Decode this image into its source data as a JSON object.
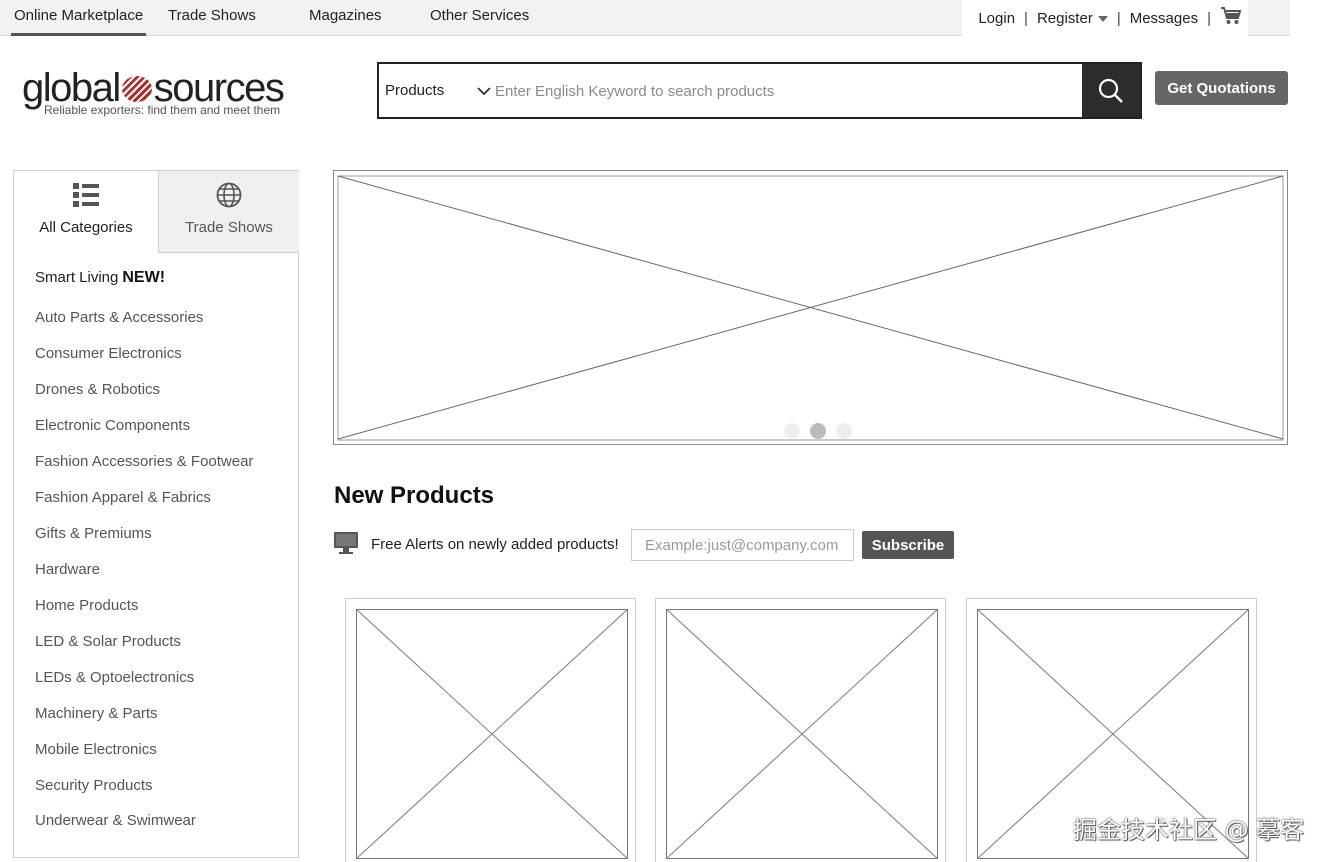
{
  "topnav": {
    "items": [
      "Online Marketplace",
      "Trade Shows",
      "Magazines",
      "Other Services"
    ],
    "active_index": 0,
    "login": "Login",
    "register": "Register",
    "messages": "Messages",
    "separator": "|",
    "cart_icon": "cart-icon"
  },
  "logo": {
    "left": "global",
    "right": "sources",
    "tagline": "Reliable exporters: find them and meet them",
    "brand_color": "#a8322e"
  },
  "search": {
    "category": "Products",
    "placeholder": "Enter English Keyword to search products",
    "button_icon": "search-icon"
  },
  "quotation_button": "Get Quotations",
  "sidebar": {
    "tabs": [
      {
        "label": "All Categories",
        "icon": "list-icon",
        "active": true
      },
      {
        "label": "Trade Shows",
        "icon": "globe-icon",
        "active": false
      }
    ],
    "first_item": {
      "label": "Smart Living",
      "badge": "NEW!"
    },
    "categories": [
      "Auto Parts & Accessories",
      "Consumer Electronics",
      "Drones & Robotics",
      "Electronic Components",
      "Fashion Accessories & Footwear",
      "Fashion Apparel & Fabrics",
      "Gifts & Premiums",
      "Hardware",
      "Home Products",
      "LED & Solar Products",
      "LEDs & Optoelectronics",
      "Machinery & Parts",
      "Mobile Electronics",
      "Security Products",
      "Underwear & Swimwear"
    ]
  },
  "banner": {
    "slide_count": 3,
    "active_slide": 1
  },
  "new_products": {
    "title": "New Products",
    "alert_text": "Free Alerts on newly added products!",
    "email_placeholder": "Example:just@company.com",
    "subscribe": "Subscribe",
    "card_count": 3
  },
  "watermark": "掘金技术社区 @ 摹客",
  "colors": {
    "dark_button": "#2c2c2c",
    "grey_button": "#666666",
    "subscribe_button": "#555555"
  }
}
